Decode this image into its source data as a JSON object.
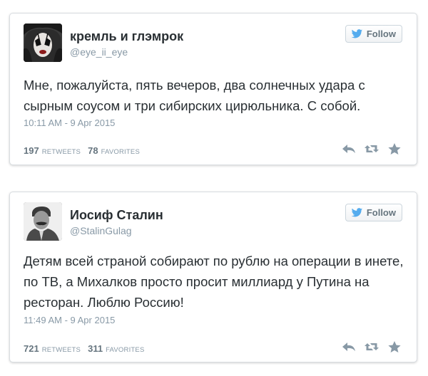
{
  "colors": {
    "text": "#292f33",
    "muted": "#8899a6",
    "twitter_blue": "#55acee",
    "icon_gray": "#8899a6",
    "border": "#d9dde1"
  },
  "tweets": [
    {
      "display_name": "кремль и глэмрок",
      "screen_name": "@eye_ii_eye",
      "avatar_icon": "glam-rock-avatar",
      "follow_label": "Follow",
      "text": "Мне, пожалуйста, пять вечеров, два солнечных удара с сырным соусом и три сибирских цирюльника. С собой.",
      "timestamp": "10:11 AM - 9 Apr 2015",
      "retweets": "197",
      "retweets_label": "RETWEETS",
      "favorites": "78",
      "favorites_label": "FAVORITES"
    },
    {
      "display_name": "Иосиф Сталин",
      "screen_name": "@StalinGulag",
      "avatar_icon": "stalin-portrait-avatar",
      "follow_label": "Follow",
      "text": "Детям всей страной собирают по рублю на операции в инете, по ТВ, а Михалков просто просит миллиард у Путина на ресторан. Люблю Россию!",
      "timestamp": "11:49 AM - 9 Apr 2015",
      "retweets": "721",
      "retweets_label": "RETWEETS",
      "favorites": "311",
      "favorites_label": "FAVORITES"
    }
  ]
}
